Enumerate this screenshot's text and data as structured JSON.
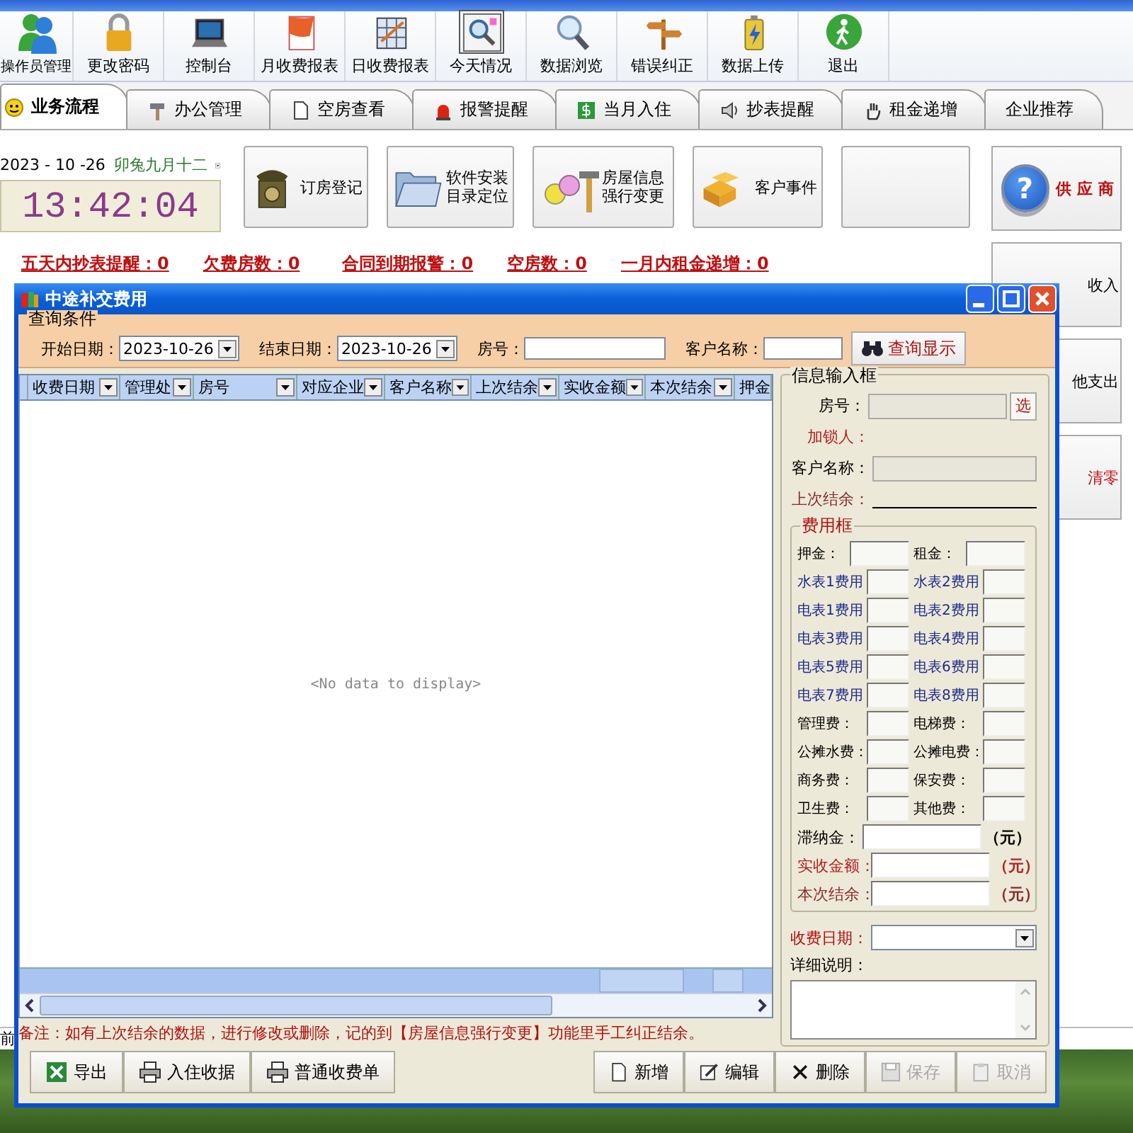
{
  "toolbar": [
    {
      "label": "操作员管理"
    },
    {
      "label": "更改密码"
    },
    {
      "label": "控制台"
    },
    {
      "label": "月收费报表"
    },
    {
      "label": "日收费报表"
    },
    {
      "label": "今天情况",
      "selected": true
    },
    {
      "label": "数据浏览"
    },
    {
      "label": "错误纠正"
    },
    {
      "label": "数据上传"
    },
    {
      "label": "退出"
    }
  ],
  "tabs": [
    {
      "label": "业务流程",
      "selected": true
    },
    {
      "label": "办公管理",
      "selected": false
    },
    {
      "label": "空房查看",
      "selected": false
    },
    {
      "label": "报警提醒",
      "selected": false
    },
    {
      "label": "当月入住",
      "selected": false
    },
    {
      "label": "抄表提醒",
      "selected": false
    },
    {
      "label": "租金递增",
      "selected": false
    },
    {
      "label": "企业推荐",
      "selected": false
    }
  ],
  "date_picker": {
    "value": "2023 - 10 -26",
    "lunar": "卯兔九月十二"
  },
  "clock": "13:42:04",
  "action_buttons": [
    {
      "kind": "phone",
      "label": "订房登记"
    },
    {
      "kind": "folder",
      "lines": [
        "软件安装",
        "目录定位"
      ]
    },
    {
      "kind": "smiley",
      "lines": [
        "房屋信息",
        "强行变更"
      ]
    },
    {
      "kind": "boxes",
      "label": "客户事件"
    },
    {
      "kind": "blank"
    }
  ],
  "alerts": [
    "五天内抄表提醒：0",
    "欠费房数：0",
    "合同到期报警：0",
    "空房数：0",
    "一月内租金递增：0"
  ],
  "side_buttons": [
    {
      "kind": "help",
      "icon": "?",
      "label": "供 应 商"
    },
    {
      "kind": "plain",
      "label": "收入"
    },
    {
      "kind": "plain",
      "label": "他支出"
    },
    {
      "kind": "red",
      "label": "清零"
    }
  ],
  "status_bar": "前",
  "dialog": {
    "title": "中途补交费用",
    "query": {
      "legend": "查询条件",
      "start_label": "开始日期：",
      "start_value": "2023-10-26",
      "end_label": "结束日期：",
      "end_value": "2023-10-26",
      "room_label": "房号：",
      "customer_label": "客户名称：",
      "button": "查询显示"
    },
    "table": {
      "columns": [
        "收费日期",
        "管理处",
        "房号",
        "对应企业",
        "客户名称",
        "上次结余",
        "实收金额",
        "本次结余",
        "押金"
      ],
      "empty_message": "<No data to display>"
    },
    "info": {
      "legend": "信息输入框",
      "fields": [
        {
          "kind": "picker",
          "label": "房号：",
          "button": "选",
          "color": "#000000"
        },
        {
          "kind": "text",
          "label": "加锁人：",
          "color": "#b22222"
        },
        {
          "kind": "input",
          "label": "客户名称：",
          "color": "#000000"
        },
        {
          "kind": "line",
          "label": "上次结余：",
          "color": "#8b2a2a"
        }
      ],
      "fee_legend": "费用框",
      "fees": [
        {
          "label": "押金：",
          "color": "#000000"
        },
        {
          "label": "租金：",
          "color": "#000000"
        },
        {
          "label": "水表1费用",
          "color": "#1c2a8c"
        },
        {
          "label": "水表2费用",
          "color": "#1c2a8c"
        },
        {
          "label": "电表1费用",
          "color": "#1c2a8c"
        },
        {
          "label": "电表2费用",
          "color": "#1c2a8c"
        },
        {
          "label": "电表3费用",
          "color": "#1c2a8c"
        },
        {
          "label": "电表4费用",
          "color": "#1c2a8c"
        },
        {
          "label": "电表5费用",
          "color": "#1c2a8c"
        },
        {
          "label": "电表6费用",
          "color": "#1c2a8c"
        },
        {
          "label": "电表7费用",
          "color": "#1c2a8c"
        },
        {
          "label": "电表8费用",
          "color": "#1c2a8c"
        },
        {
          "label": "管理费：",
          "color": "#000000"
        },
        {
          "label": "电梯费：",
          "color": "#000000"
        },
        {
          "label": "公摊水费：",
          "color": "#000000"
        },
        {
          "label": "公摊电费：",
          "color": "#000000"
        },
        {
          "label": "商务费：",
          "color": "#000000"
        },
        {
          "label": "保安费：",
          "color": "#000000"
        },
        {
          "label": "卫生费：",
          "color": "#000000"
        },
        {
          "label": "其他费：",
          "color": "#000000"
        }
      ],
      "totals": [
        {
          "label": "滞纳金：",
          "unit": "（元）",
          "color": "#000000"
        },
        {
          "label": "实收金额：",
          "unit": "（元）",
          "color": "#b22222"
        },
        {
          "label": "本次结余：",
          "unit": "（元）",
          "color": "#8b2a2a"
        }
      ],
      "date_label": "收费日期：",
      "notes_label": "详细说明："
    },
    "note": "备注：如有上次结余的数据，进行修改或删除，记的到【房屋信息强行变更】功能里手工纠正结余。",
    "left_buttons": [
      {
        "kind": "excel",
        "label": "导出"
      },
      {
        "kind": "printer",
        "label": "入住收据"
      },
      {
        "kind": "printer",
        "label": "普通收费单"
      }
    ],
    "right_buttons": [
      {
        "kind": "page",
        "label": "新增",
        "disabled": false
      },
      {
        "kind": "edit",
        "label": "编辑",
        "disabled": false
      },
      {
        "kind": "cross",
        "label": "删除",
        "disabled": false
      },
      {
        "kind": "disk",
        "label": "保存",
        "disabled": true
      },
      {
        "kind": "clipboard",
        "label": "取消",
        "disabled": true
      }
    ]
  }
}
